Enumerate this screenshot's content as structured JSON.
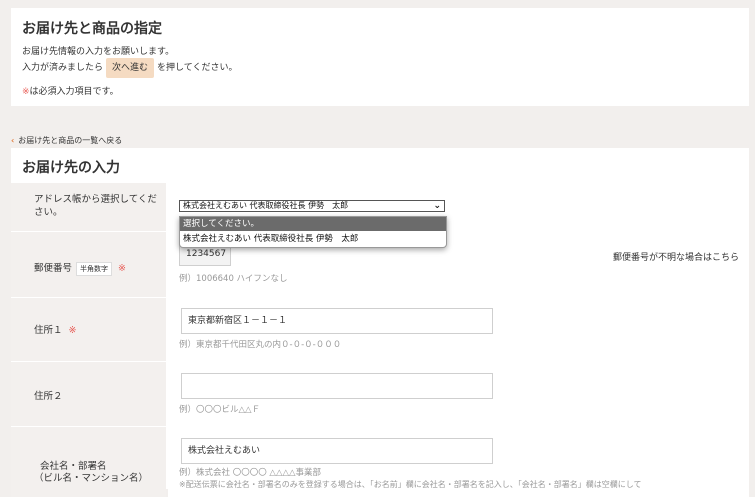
{
  "header": {
    "title": "お届け先と商品の指定",
    "line1": "お届け先情報の入力をお願いします。",
    "line2_pre": "入力が済みましたら",
    "next_label": "次へ進む",
    "line2_post": "を押してください。",
    "required_mark": "※",
    "required_text": "は必須入力項目です。"
  },
  "back_link": "お届け先と商品の一覧へ戻る",
  "form": {
    "title": "お届け先の入力",
    "address_book": {
      "label": "アドレス帳から選択してください。",
      "selected": "株式会社えむあい 代表取締役社長 伊勢　太郎",
      "options": [
        "選択してください。",
        "株式会社えむあい 代表取締役社長 伊勢　太郎"
      ]
    },
    "postal": {
      "label": "郵便番号",
      "tag": "半角数字",
      "required": "※",
      "value": "1234567",
      "hint": "例）1006640 ハイフンなし",
      "unknown_link": "郵便番号が不明な場合はこちら"
    },
    "address1": {
      "label": "住所１",
      "required": "※",
      "value": "東京都新宿区１－１－１",
      "hint": "例）東京都千代田区丸の内０-０-０-０００"
    },
    "address2": {
      "label": "住所２",
      "value": "",
      "hint": "例）〇〇〇ビル△△Ｆ"
    },
    "company": {
      "label_line1": "会社名・部署名",
      "label_line2": "（ビル名・マンション名）",
      "value": "株式会社えむあい",
      "hint": "例）株式会社 〇〇〇〇 △△△△事業部",
      "note": "※配送伝票に会社名・部署名のみを登録する場合は、「お名前」欄に会社名・部署名を記入し、「会社名・部署名」欄は空欄にして"
    }
  }
}
